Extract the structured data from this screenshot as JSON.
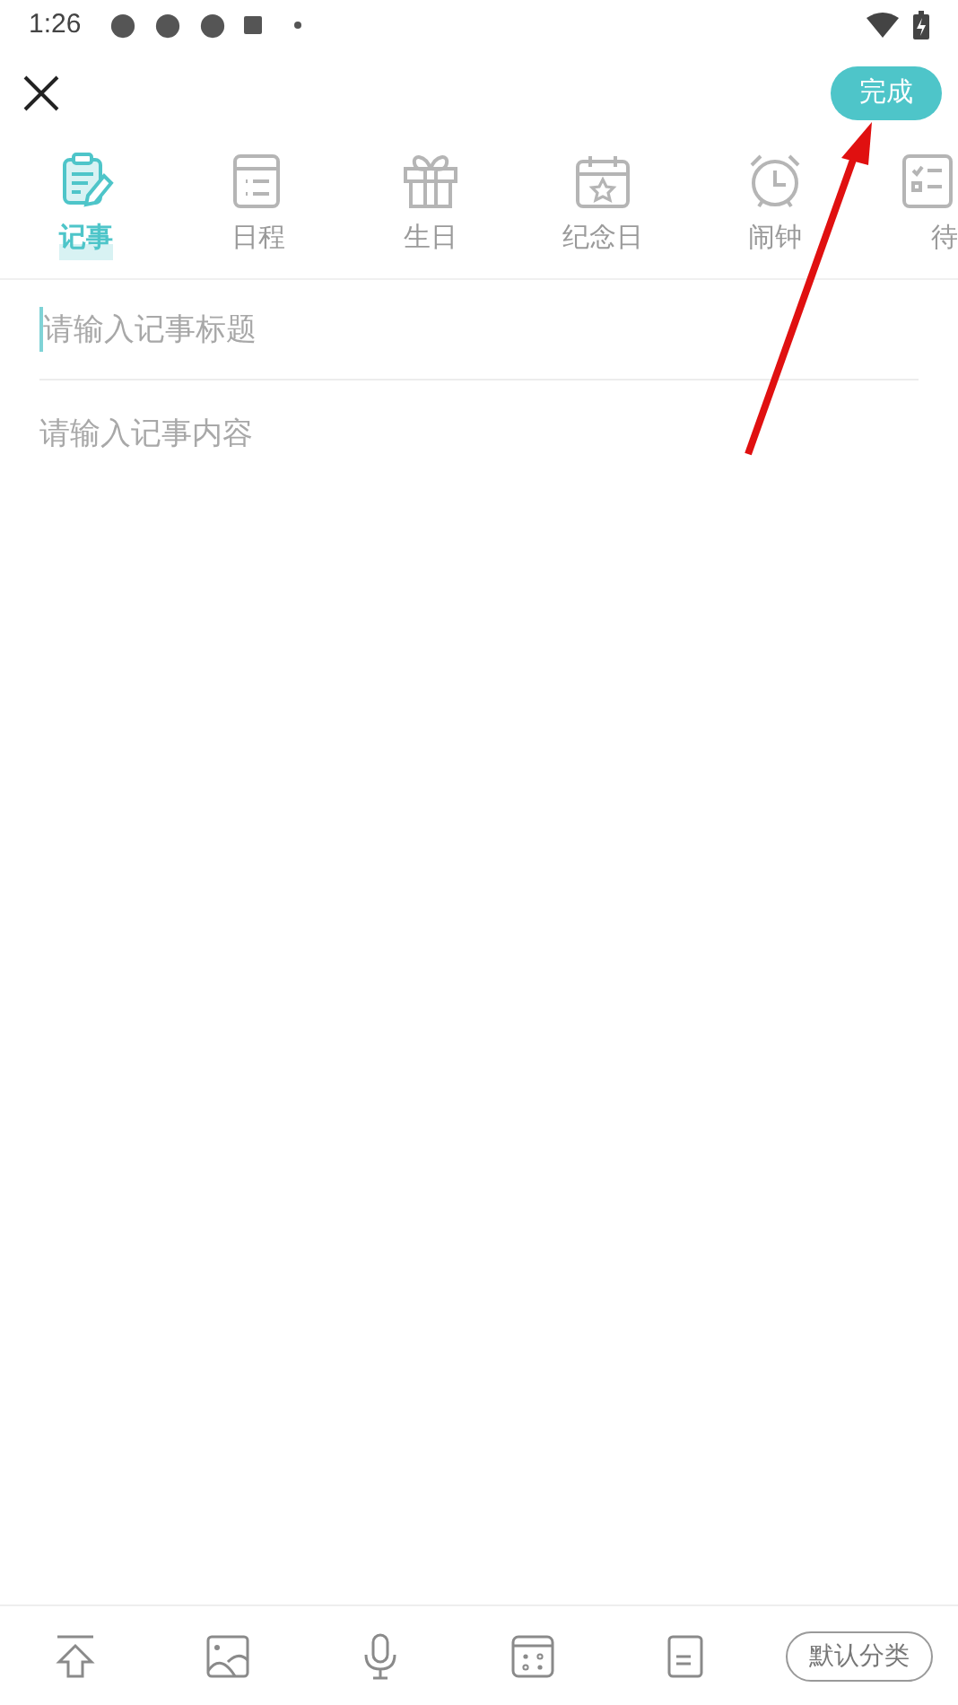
{
  "status_bar": {
    "time": "1:26"
  },
  "header": {
    "done_button": "完成"
  },
  "tabs": [
    {
      "label": "记事",
      "kind": "note",
      "selected": true
    },
    {
      "label": "日程",
      "kind": "schedule",
      "selected": false
    },
    {
      "label": "生日",
      "kind": "gift",
      "selected": false
    },
    {
      "label": "纪念日",
      "kind": "anniversary",
      "selected": false
    },
    {
      "label": "闹钟",
      "kind": "alarm",
      "selected": false
    },
    {
      "label": "待",
      "kind": "todo",
      "selected": false
    }
  ],
  "title_field": {
    "placeholder": "请输入记事标题"
  },
  "content_field": {
    "placeholder": "请输入记事内容"
  },
  "toolbar": {
    "category": "默认分类"
  }
}
